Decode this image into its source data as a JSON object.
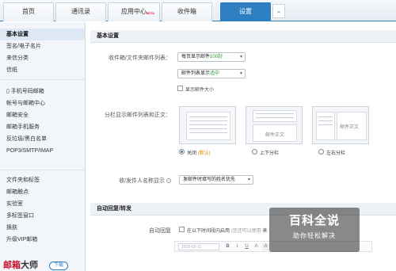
{
  "tabs": [
    {
      "label": "首页"
    },
    {
      "label": "通讯录"
    },
    {
      "label": "应用中心",
      "badge": "BETA"
    },
    {
      "label": "收件箱"
    },
    {
      "label": "设置"
    }
  ],
  "tab_more_icon": "chevron-down-icon",
  "sidebar": {
    "items": [
      "基本设置",
      "签名/电子名片",
      "来信分类",
      "信纸",
      "手机号码邮箱",
      "帐号与邮箱中心",
      "邮箱安全",
      "邮箱手机服务",
      "反垃圾/黑白名单",
      "POP3/SMTP/IMAP",
      "文件夹和标签",
      "邮箱触点",
      "实验室",
      "多标签窗口",
      "换肤",
      "升级VIP邮箱"
    ],
    "brand_a": "邮箱",
    "brand_b": "大师",
    "download_label": "下载"
  },
  "main": {
    "section1_title": "基本设置",
    "row1_label": "收件箱/文件夹邮件列表：",
    "select_per_page_prefix": "每页显示邮件",
    "select_per_page_value": "100封",
    "select_density_prefix": "邮件列表显示",
    "select_density_value": "适中",
    "show_size_label": "显示邮件大小",
    "row2_label": "分栏显示邮件列表和正文：",
    "thumb_text": "邮件正文",
    "radio_off": "关闭",
    "radio_default": "(默认)",
    "radio_updown": "上下分栏",
    "radio_leftright": "左右分栏",
    "row3_label": "收/发件人名称显示",
    "info_icon": "?",
    "select_name_display": "发邮件时填写的姓名优先",
    "section2_title": "自动回复/转发",
    "auto_reply_label": "自动回复",
    "auto_reply_option": "在以下时间段内启用",
    "auto_reply_hint": "(您还可以使用",
    "auto_reply_hint_tail": "来",
    "date_value": "2015-02-11",
    "toolbar_buttons": [
      "B",
      "I",
      "U",
      "A",
      "A"
    ]
  },
  "watermark": {
    "title": "百科全说",
    "subtitle": "助你轻松解决"
  },
  "colors": {
    "accent": "#2d7fc1",
    "brand": "#c8102e"
  }
}
